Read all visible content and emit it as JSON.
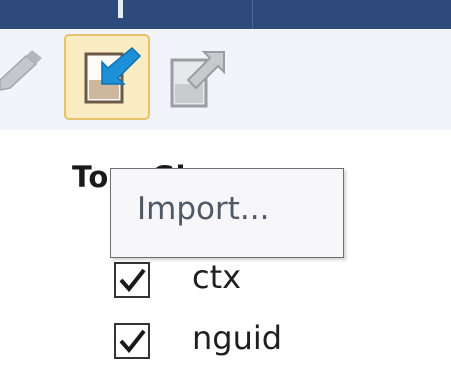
{
  "colors": {
    "title_bar": "#2e4a7a",
    "toolbar_bg": "#f1f4f9",
    "import_highlight": "#fbedc3",
    "import_highlight_border": "#e6c26d",
    "import_arrow": "#1e90d8",
    "check": "#1a1a1a"
  },
  "toolbar": {
    "prev_icon": "pencil-icon",
    "import_icon": "import-icon",
    "export_icon": "export-icon"
  },
  "table": {
    "header_text": "To          n Glo"
  },
  "tooltip": {
    "text": "Import..."
  },
  "rows": [
    {
      "label": "ctx",
      "checked": true
    },
    {
      "label": "nguid",
      "checked": true
    }
  ]
}
